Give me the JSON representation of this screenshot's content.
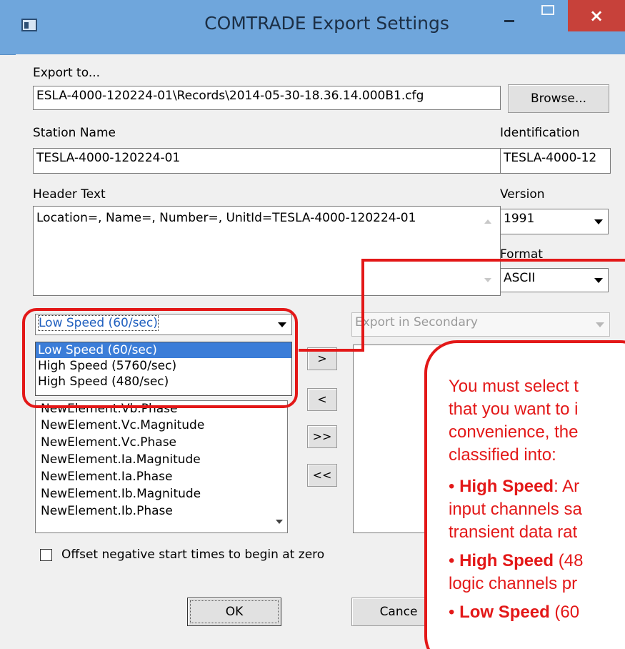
{
  "window": {
    "title": "COMTRADE Export Settings",
    "close_glyph": "×"
  },
  "export_to": {
    "label": "Export to...",
    "value": "ESLA-4000-120224-01\\Records\\2014-05-30-18.36.14.000B1.cfg",
    "browse_label": "Browse..."
  },
  "station": {
    "label": "Station Name",
    "value": "TESLA-4000-120224-01"
  },
  "identification": {
    "label": "Identification",
    "value": "TESLA-4000-12"
  },
  "header_text": {
    "label": "Header Text",
    "value": "Location=, Name=, Number=, UnitId=TESLA-4000-120224-01"
  },
  "version": {
    "label": "Version",
    "value": "1991"
  },
  "format": {
    "label": "Format",
    "value": "ASCII"
  },
  "speed_select": {
    "value": "Low Speed (60/sec)",
    "options": [
      "Low Speed (60/sec)",
      "High Speed (5760/sec)",
      "High Speed (480/sec)"
    ]
  },
  "export_mode": {
    "value": "Export in Secondary"
  },
  "channels": [
    "NewElement.Vb.Phase",
    "NewElement.Vc.Magnitude",
    "NewElement.Vc.Phase",
    "NewElement.Ia.Magnitude",
    "NewElement.Ia.Phase",
    "NewElement.Ib.Magnitude",
    "NewElement.Ib.Phase"
  ],
  "move_buttons": {
    "add": ">",
    "remove": "<",
    "add_all": ">>",
    "remove_all": "<<"
  },
  "offset_option": {
    "label": "Offset negative start times to begin at zero",
    "checked": false
  },
  "ok_label": "OK",
  "cancel_label": "Cance",
  "annotation": {
    "line1": "You must select t",
    "line2": "that you want to i",
    "line3": "convenience, the",
    "line4": "classified into:",
    "b1_bold": "High Speed",
    "b1_rest": ": Ar",
    "line6": "input channels sa",
    "line7": "transient data rat",
    "b2_bold": "High Speed",
    "b2_rest": " (48",
    "line9": "logic channels pr",
    "b3_bold": "Low Speed",
    "b3_rest": " (60",
    "bullet": "•",
    "color": "#e31818"
  },
  "colors": {
    "titlebar": "#6fa6dc",
    "close": "#c7413a",
    "selection": "#3b7dd8",
    "annotation": "#e31818"
  }
}
